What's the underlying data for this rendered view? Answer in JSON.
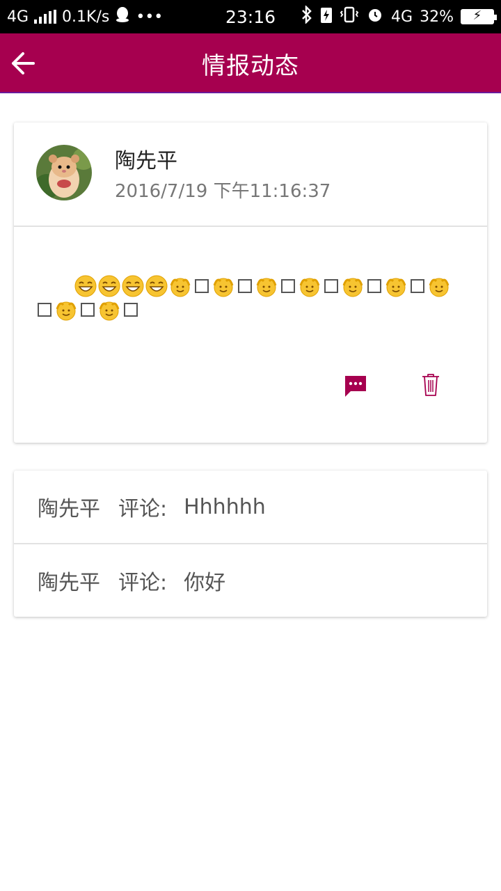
{
  "status_bar": {
    "network_left": "4G",
    "speed": "0.1K/s",
    "more": "•••",
    "time": "23:16",
    "network_right": "4G",
    "battery": "32%"
  },
  "app_bar": {
    "title": "情报动态",
    "background": "#a6004f"
  },
  "post": {
    "author": "陶先平",
    "time": "2016/7/19 下午11:16:37",
    "content_icons": "laughing-emoji x4, then alternating smile-emoji and missing-glyph boxes",
    "actions": {
      "comment_icon": "comment-icon",
      "delete_icon": "trash-icon"
    }
  },
  "comments": [
    {
      "author": "陶先平",
      "label": "评论:",
      "text": "Hhhhhh"
    },
    {
      "author": "陶先平",
      "label": "评论:",
      "text": "你好"
    }
  ],
  "colors": {
    "accent": "#a6004f",
    "divider": "#e2e2e2"
  }
}
